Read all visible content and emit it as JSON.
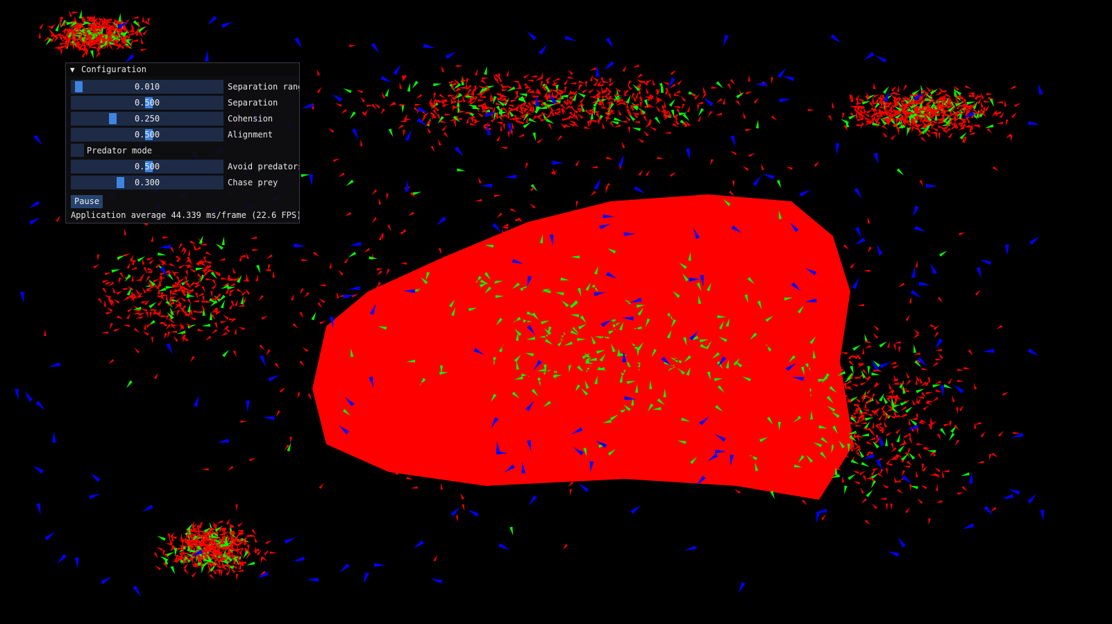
{
  "colors": {
    "background": "#000000",
    "boid": "#ff0000",
    "leader": "#00ff00",
    "predator": "#0000ff",
    "slider_grab": "#3d85e0",
    "frame_bg": "#1d2b46"
  },
  "config_window": {
    "title": "Configuration",
    "collapse_icon": "triangle-down-icon",
    "sliders": [
      {
        "value_text": "0.010",
        "value": 0.01,
        "label": "Separation range"
      },
      {
        "value_text": "0.500",
        "value": 0.5,
        "label": "Separation"
      },
      {
        "value_text": "0.250",
        "value": 0.25,
        "label": "Cohension"
      },
      {
        "value_text": "0.500",
        "value": 0.5,
        "label": "Alignment"
      }
    ],
    "predator_mode": {
      "label": "Predator mode",
      "checked": false
    },
    "predator_sliders": [
      {
        "value_text": "0.500",
        "value": 0.5,
        "label": "Avoid predators"
      },
      {
        "value_text": "0.300",
        "value": 0.3,
        "label": "Chase prey"
      }
    ],
    "pause_label": "Pause",
    "status": "Application average 44.339 ms/frame (22.6 FPS)"
  }
}
